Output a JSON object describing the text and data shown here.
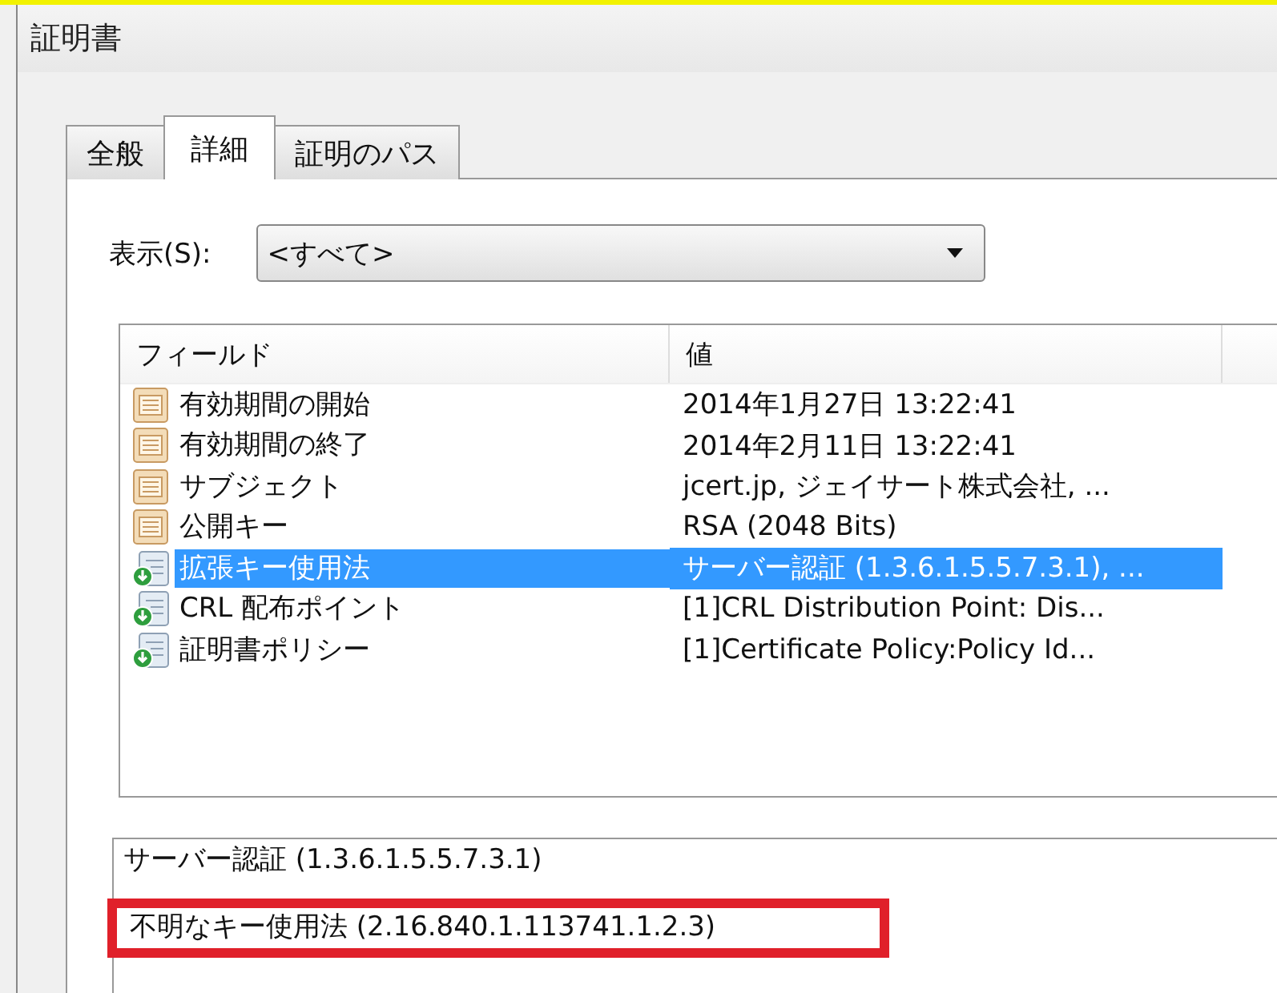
{
  "window": {
    "title": "証明書"
  },
  "tabs": [
    {
      "label": "全般",
      "selected": false
    },
    {
      "label": "詳細",
      "selected": true
    },
    {
      "label": "証明のパス",
      "selected": false
    }
  ],
  "show": {
    "label": "表示(S):",
    "value": "<すべて>"
  },
  "table": {
    "columns": [
      "フィールド",
      "値"
    ],
    "rows": [
      {
        "field": "有効期間の開始",
        "value": "2014年1月27日  13:22:41",
        "kind": "basic",
        "selected": false
      },
      {
        "field": "有効期間の終了",
        "value": "2014年2月11日  13:22:41",
        "kind": "basic",
        "selected": false
      },
      {
        "field": "サブジェクト",
        "value": "jcert.jp, ジェイサート株式会社, ...",
        "kind": "basic",
        "selected": false
      },
      {
        "field": "公開キー",
        "value": "RSA (2048 Bits)",
        "kind": "basic",
        "selected": false
      },
      {
        "field": "拡張キー使用法",
        "value": "サーバー認証 (1.3.6.1.5.5.7.3.1), ...",
        "kind": "extension",
        "selected": true
      },
      {
        "field": "CRL 配布ポイント",
        "value": "[1]CRL Distribution Point: Dis...",
        "kind": "extension",
        "selected": false
      },
      {
        "field": "証明書ポリシー",
        "value": "[1]Certificate Policy:Policy Id...",
        "kind": "extension",
        "selected": false
      }
    ]
  },
  "details": {
    "lines": [
      {
        "text": "サーバー認証 (1.3.6.1.5.5.7.3.1)",
        "highlighted": false
      },
      {
        "text": "不明なキー使用法 (2.16.840.1.113741.1.2.3)",
        "highlighted": true
      }
    ]
  }
}
